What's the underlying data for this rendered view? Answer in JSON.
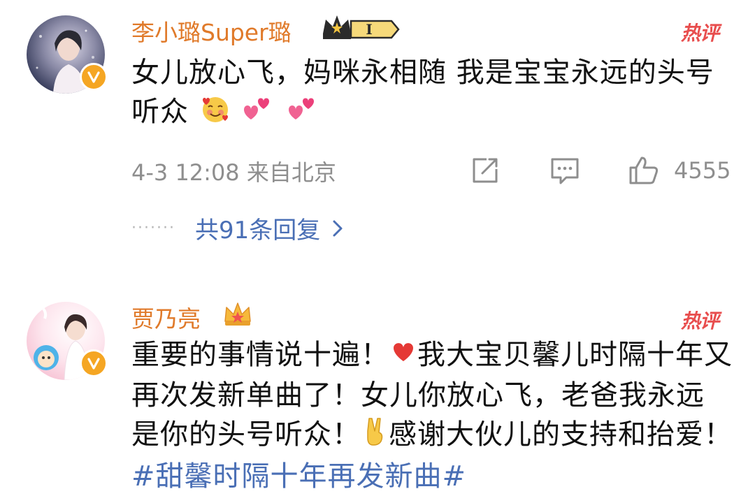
{
  "comments": [
    {
      "username": "李小璐Super璐",
      "level_badge": "I",
      "hot_label": "热评",
      "text": "女儿放心飞，妈咪永相随 我是宝宝永远的头号听众",
      "meta": "4-3 12:08 来自北京",
      "like_count": "4555",
      "replies_label": "共91条回复"
    },
    {
      "username": "贾乃亮",
      "hot_label": "热评",
      "text_part1": "重要的事情说十遍！",
      "text_part2": "我大宝贝馨儿时隔十年又再次发新单曲了！女儿你放心飞，老爸我永远是你的头号听众！",
      "text_part3": "感谢大伙儿的支持和抬爱！",
      "hashtag": "#甜馨时隔十年再发新曲#"
    }
  ],
  "icons": {
    "verified": "verified-v-icon",
    "crown_badge": "crown-level-icon",
    "crown_small": "crown-icon",
    "share": "share-icon",
    "comment": "comment-icon",
    "like": "thumbs-up-icon",
    "chevron": "chevron-right-icon",
    "emoji_hug": "smiling-face-with-hearts-emoji",
    "emoji_hearts": "two-hearts-emoji",
    "emoji_heart": "red-heart-emoji",
    "emoji_victory": "victory-hand-emoji"
  },
  "colors": {
    "username": "#e07a2a",
    "hot": "#e84e4e",
    "link": "#4a6fb5",
    "meta": "#8e8e8e",
    "verified": "#f5a623"
  }
}
